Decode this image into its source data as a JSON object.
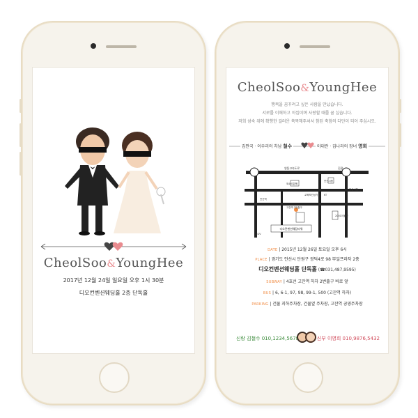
{
  "left_phone": {
    "couple_title": "CheolSoo",
    "couple_title_amp": "&",
    "couple_title_2": "YoungHee",
    "datetime_line": "2017년 12월 24일 일요일 오후 1시 30분",
    "venue_line": "디오컨벤션웨딩홀 2층 단독홀"
  },
  "right_phone": {
    "couple_title": "CheolSoo",
    "couple_title_amp": "&",
    "couple_title_2": "YoungHee",
    "invite_lines": [
      "행복을 꿈꾸려고 싶은 사람을 만났습니다.",
      "서로를 이해하고 아낌이며 사랑할 때를 꿈 싶습니다.",
      "저희 성숙 위에 확행한 걸러운 축복해주셔서 참된 축함의 다단이 되어 주십시오."
    ],
    "groom_family": "김판국 · 이우리의 차남",
    "groom_name": "철수",
    "bride_family": "이대란 · 김나라의 장녀",
    "bride_name": "영희",
    "map_labels": {
      "top_road": "영동고속도로",
      "exit": "진관",
      "left_station": "안산역",
      "bank": "외소리은행",
      "center1": "교육보건상가",
      "center2": "KT",
      "center3": "안산시청",
      "right_lbl": "안산시청",
      "bldg": "고잔역 2번출구",
      "marker": "디오컨벤션웨딩타워",
      "bottom_left": "CGV",
      "bottom_right": "2001아울렛"
    },
    "date_label": "DATE",
    "date_value": "2015년 12월 26일 토요일 오후 6시",
    "place_label": "PLACE",
    "place_value": "경기도 안산시 단원구 광덕4로 98 부일프라자 2층",
    "place_name": "디오컨벤션웨딩홀 단독홀",
    "place_phone": "(☎031,487,9595)",
    "subway_label": "SUBWAY",
    "subway_value": "4호선 고잔역 하차 2번출구 바로 앞",
    "bus_label": "BUS",
    "bus_value": "6, 6-1, 97, 98, 99-1, 500 (고잔역 하차)",
    "parking_label": "PARKING",
    "parking_value": "건물 지하주차장, 건물옆 주차장, 고잔역 공영주차장",
    "groom_contact_label": "신랑",
    "groom_contact_name": "김철수",
    "groom_contact_phone": "010,1234,5678",
    "bride_contact_label": "신부",
    "bride_contact_name": "이영희",
    "bride_contact_phone": "010,9876,5432"
  },
  "colors": {
    "accent_orange": "#f08a40",
    "groom_green": "#3a8a3a",
    "bride_red": "#d04a5a",
    "heart_pink": "#e98b8f",
    "heart_dark": "#444444",
    "phone_gold": "#e8dcc3"
  },
  "icons": [
    "heart-icon",
    "arrow-icon",
    "home-button-icon",
    "camera-icon",
    "speaker-icon"
  ]
}
